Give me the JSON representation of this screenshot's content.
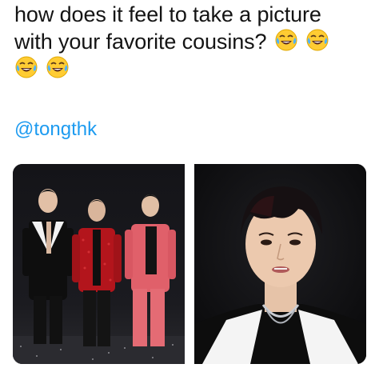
{
  "post": {
    "caption_line1": "how does it feel to take a picture",
    "caption_line2": "with your favorite cousins?",
    "emoji_name": "face-with-tears-of-joy",
    "mention": "@tongthk"
  },
  "media": {
    "images": [
      {
        "name": "three-men-on-stage-photo"
      },
      {
        "name": "closeup-portrait-photo"
      }
    ]
  },
  "colors": {
    "text": "#141414",
    "link": "#1d9bf0",
    "background": "#ffffff"
  }
}
